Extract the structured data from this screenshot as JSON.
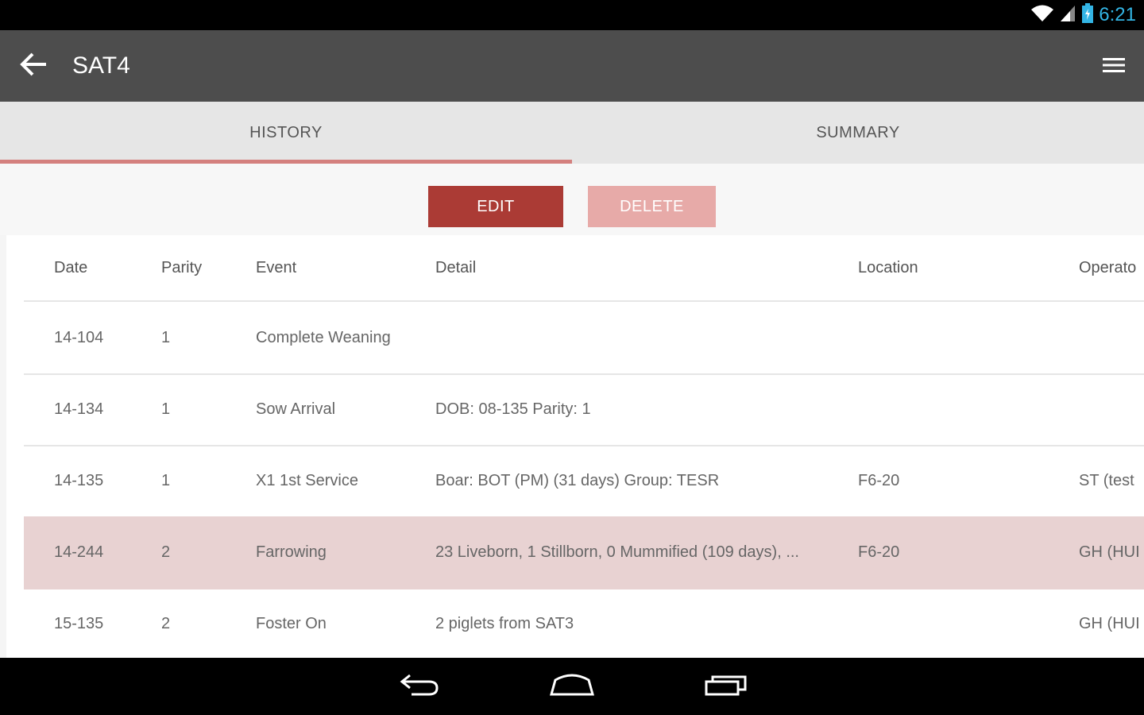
{
  "status_bar": {
    "time": "6:21"
  },
  "action_bar": {
    "title": "SAT4"
  },
  "tabs": [
    {
      "label": "HISTORY",
      "active": true
    },
    {
      "label": "SUMMARY",
      "active": false
    }
  ],
  "toolbar": {
    "edit_label": "EDIT",
    "delete_label": "DELETE"
  },
  "table": {
    "headers": {
      "date": "Date",
      "parity": "Parity",
      "event": "Event",
      "detail": "Detail",
      "location": "Location",
      "operator": "Operato"
    },
    "rows": [
      {
        "date": "14-104",
        "parity": "1",
        "event": "Complete Weaning",
        "detail": "",
        "location": "",
        "operator": ""
      },
      {
        "date": "14-134",
        "parity": "1",
        "event": "Sow Arrival",
        "detail": "DOB: 08-135 Parity: 1",
        "location": "",
        "operator": ""
      },
      {
        "date": "14-135",
        "parity": "1",
        "event": "X1 1st Service",
        "detail": "Boar: BOT (PM) (31 days) Group: TESR",
        "location": "F6-20",
        "operator": "ST (test"
      },
      {
        "date": "14-244",
        "parity": "2",
        "event": "Farrowing",
        "detail": "23 Liveborn, 1 Stillborn, 0 Mummified (109 days), ...",
        "location": "F6-20",
        "operator": "GH (HUI"
      },
      {
        "date": "15-135",
        "parity": "2",
        "event": "Foster On",
        "detail": "2 piglets from SAT3",
        "location": "",
        "operator": "GH (HUI"
      }
    ]
  },
  "colors": {
    "action_bar": "#4d4d4d",
    "tab_indicator": "#d4807e",
    "edit_button": "#ab3b35",
    "delete_button": "#e7aaa8",
    "selected_row": "#e8d2d2",
    "status_time": "#33b5e5"
  },
  "icons": {
    "back": "arrow-left-icon",
    "menu": "hamburger-menu-icon",
    "wifi": "wifi-icon",
    "signal": "signal-icon",
    "battery": "battery-icon",
    "nav_back": "nav-back-icon",
    "nav_home": "nav-home-icon",
    "nav_recents": "nav-recents-icon"
  }
}
